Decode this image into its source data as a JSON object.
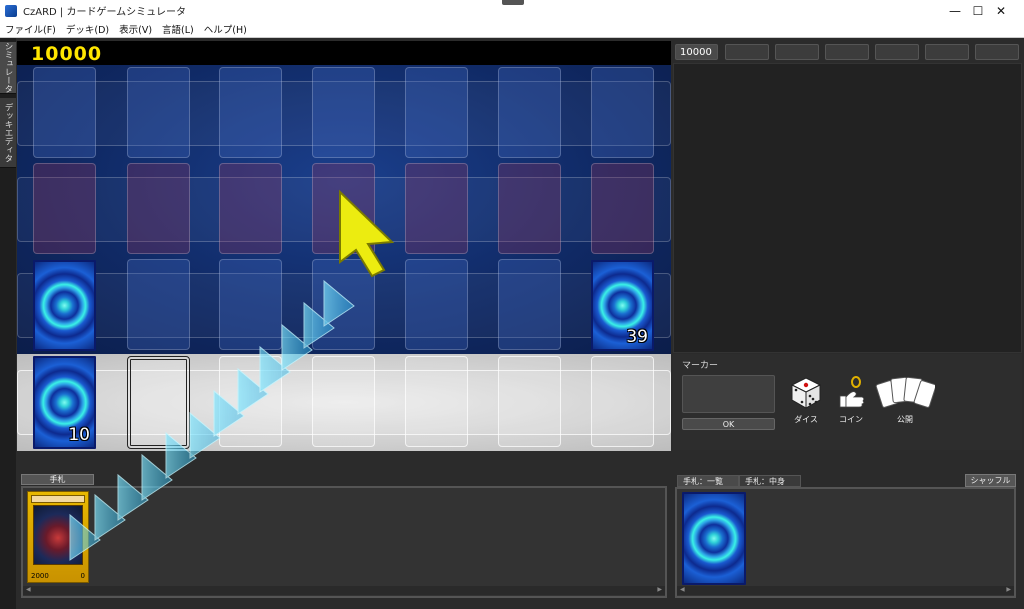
{
  "window": {
    "title": "CzARD | カードゲームシミュレータ",
    "min_glyph": "—",
    "max_glyph": "☐",
    "close_glyph": "✕"
  },
  "menu": [
    {
      "label": "ファイル(F)"
    },
    {
      "label": "デッキ(D)"
    },
    {
      "label": "表示(V)"
    },
    {
      "label": "言語(L)"
    },
    {
      "label": "ヘルプ(H)"
    }
  ],
  "side_tabs": {
    "simulator": "シミュレータ",
    "deck_editor": "デッキエディタ"
  },
  "board": {
    "score": "10000",
    "opponent_deck_count": "39",
    "my_deck_count": "10"
  },
  "right_tabs": [
    {
      "label": "10000",
      "active": true
    },
    {
      "label": ""
    },
    {
      "label": ""
    },
    {
      "label": ""
    },
    {
      "label": ""
    },
    {
      "label": ""
    },
    {
      "label": ""
    }
  ],
  "tools": {
    "marker_label": "マーカー",
    "ok_label": "OK",
    "dice_label": "ダイス",
    "coin_label": "コイン",
    "reveal_label": "公開"
  },
  "hand": {
    "header_label": "手札",
    "card_atk": "2000",
    "card_def": "0"
  },
  "hand_right": {
    "tab_list": "手札：一覧",
    "tab_content": "手札：中身",
    "shuffle_label": "シャッフル"
  }
}
